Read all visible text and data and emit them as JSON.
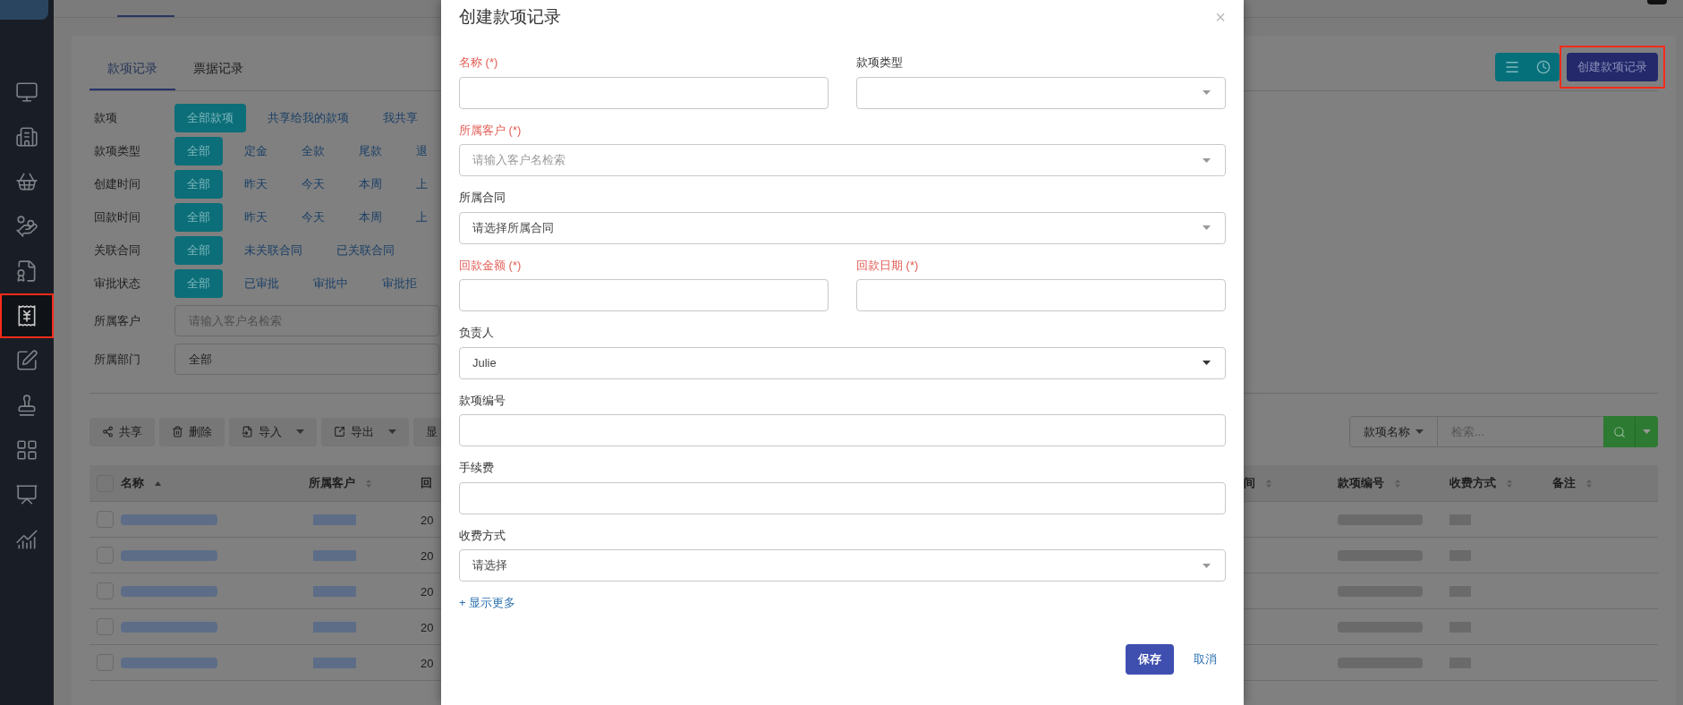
{
  "sidebar": {
    "items": [
      {
        "selected": false
      },
      {
        "selected": false
      },
      {
        "selected": false
      },
      {
        "selected": false
      },
      {
        "selected": false
      },
      {
        "selected": true,
        "highlighted": true
      },
      {
        "selected": false
      },
      {
        "selected": false
      },
      {
        "selected": false
      },
      {
        "selected": false
      },
      {
        "selected": false
      }
    ]
  },
  "page": {
    "tabs": [
      {
        "label": "款项记录",
        "selected": true
      },
      {
        "label": "票据记录",
        "selected": false
      }
    ],
    "actions": {
      "create_button": {
        "label": "创建款项记录",
        "highlighted": true
      }
    },
    "filters": [
      {
        "label": "款项",
        "options": [
          {
            "label": "全部款项",
            "selected": true
          },
          {
            "label": "共享给我的款项",
            "selected": false
          },
          {
            "label": "我共享",
            "selected": false
          }
        ]
      },
      {
        "label": "款项类型",
        "options": [
          {
            "label": "全部",
            "selected": true
          },
          {
            "label": "定金",
            "selected": false
          },
          {
            "label": "全款",
            "selected": false
          },
          {
            "label": "尾款",
            "selected": false
          },
          {
            "label": "退",
            "selected": false
          }
        ]
      },
      {
        "label": "创建时间",
        "options": [
          {
            "label": "全部",
            "selected": true
          },
          {
            "label": "昨天",
            "selected": false
          },
          {
            "label": "今天",
            "selected": false
          },
          {
            "label": "本周",
            "selected": false
          },
          {
            "label": "上",
            "selected": false
          }
        ]
      },
      {
        "label": "回款时间",
        "options": [
          {
            "label": "全部",
            "selected": true
          },
          {
            "label": "昨天",
            "selected": false
          },
          {
            "label": "今天",
            "selected": false
          },
          {
            "label": "本周",
            "selected": false
          },
          {
            "label": "上",
            "selected": false
          }
        ]
      },
      {
        "label": "关联合同",
        "options": [
          {
            "label": "全部",
            "selected": true
          },
          {
            "label": "未关联合同",
            "selected": false
          },
          {
            "label": "已关联合同",
            "selected": false
          }
        ]
      },
      {
        "label": "审批状态",
        "options": [
          {
            "label": "全部",
            "selected": true
          },
          {
            "label": "已审批",
            "selected": false
          },
          {
            "label": "审批中",
            "selected": false
          },
          {
            "label": "审批拒",
            "selected": false
          }
        ]
      }
    ],
    "filter_fields": [
      {
        "label": "所属客户",
        "placeholder": "请输入客户名检索"
      },
      {
        "label": "所属部门",
        "value": "全部"
      }
    ],
    "toolbar": [
      {
        "label": "共享",
        "dropdown": false
      },
      {
        "label": "删除",
        "dropdown": false
      },
      {
        "label": "导入",
        "dropdown": true
      },
      {
        "label": "导出",
        "dropdown": true
      },
      {
        "label": "显",
        "dropdown": false
      }
    ],
    "search": {
      "field_label": "款项名称",
      "placeholder": "检索..."
    },
    "table": {
      "select_all_checked": false,
      "columns": [
        {
          "label": "名称",
          "sortable": true,
          "sorted": true
        },
        {
          "label": "所属客户",
          "sortable": true,
          "sorted": false
        },
        {
          "label": "回"
        },
        {
          "label": "间",
          "sortable": true,
          "sorted": false
        },
        {
          "label": "款项编号",
          "sortable": true,
          "sorted": false
        },
        {
          "label": "收费方式",
          "sortable": true,
          "sorted": false
        },
        {
          "label": "备注",
          "sortable": true,
          "sorted": false
        }
      ],
      "rows": [
        {
          "checked": false,
          "column_3": "20"
        },
        {
          "checked": false,
          "column_3": "20"
        },
        {
          "checked": false,
          "column_3": "20"
        },
        {
          "checked": false,
          "column_3": "20"
        },
        {
          "checked": false,
          "column_3": "20"
        }
      ]
    }
  },
  "dialog": {
    "title": "创建款项记录",
    "close": "×",
    "fields": [
      {
        "label": "名称 (*)",
        "required": true,
        "kind": "text",
        "half": true
      },
      {
        "label": "款项类型",
        "required": false,
        "kind": "select",
        "half": true
      },
      {
        "label": "所属客户 (*)",
        "required": true,
        "kind": "select",
        "half": false,
        "placeholder": "请输入客户名检索"
      },
      {
        "label": "所属合同",
        "required": false,
        "kind": "select",
        "half": false,
        "value": "请选择所属合同"
      },
      {
        "label": "回款金额 (*)",
        "required": true,
        "kind": "text",
        "half": true
      },
      {
        "label": "回款日期 (*)",
        "required": true,
        "kind": "text",
        "half": true
      },
      {
        "label": "负责人",
        "required": false,
        "kind": "select",
        "half": false,
        "value": "Julie"
      },
      {
        "label": "款项编号",
        "required": false,
        "kind": "text",
        "half": false
      },
      {
        "label": "手续费",
        "required": false,
        "kind": "text",
        "half": false
      },
      {
        "label": "收费方式",
        "required": false,
        "kind": "select",
        "half": false,
        "value": "请选择"
      }
    ],
    "show_more": "+ 显示更多",
    "save": "保存",
    "cancel": "取消"
  }
}
